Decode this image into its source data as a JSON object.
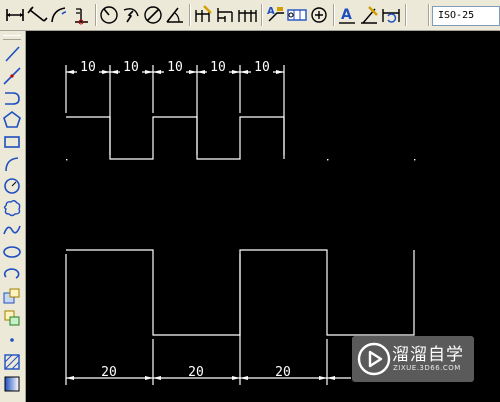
{
  "toolbar": {
    "dimension_style": "ISO-25",
    "icons": [
      "linear-dimension-icon",
      "aligned-dimension-icon",
      "arc-length-icon",
      "ordinate-icon",
      "radius-icon",
      "jogged-icon",
      "diameter-icon",
      "angular-icon",
      "quick-dimension-icon",
      "baseline-icon",
      "continue-icon",
      "quick-leader-icon",
      "tolerance-icon",
      "center-mark-icon",
      "dimension-edit-icon",
      "dimension-text-edit-icon",
      "dimension-update-icon"
    ]
  },
  "left_toolbar": {
    "icons": [
      "line-icon",
      "construction-line-icon",
      "polyline-icon",
      "polygon-icon",
      "rectangle-icon",
      "arc-icon",
      "circle-icon",
      "revision-cloud-icon",
      "spline-icon",
      "ellipse-icon",
      "ellipse-arc-icon",
      "insert-block-icon",
      "make-block-icon",
      "point-icon",
      "hatch-icon",
      "gradient-icon"
    ]
  },
  "drawing": {
    "top_dimensions": [
      "10",
      "10",
      "10",
      "10",
      "10"
    ],
    "bottom_dimensions": [
      "20",
      "20",
      "20"
    ]
  },
  "watermark": {
    "title": "溜溜自学",
    "subtitle": "ZIXUE.3D66.COM"
  }
}
